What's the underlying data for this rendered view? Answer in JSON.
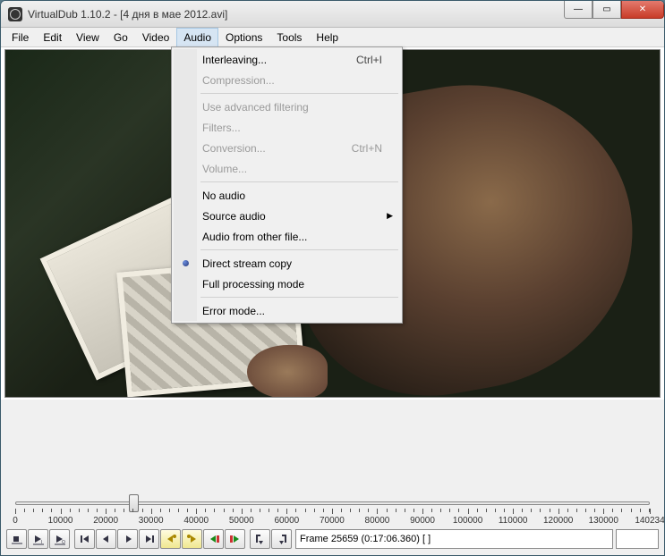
{
  "title": "VirtualDub 1.10.2 - [4 дня в мае 2012.avi]",
  "menus": {
    "file": "File",
    "edit": "Edit",
    "view": "View",
    "go": "Go",
    "video": "Video",
    "audio": "Audio",
    "options": "Options",
    "tools": "Tools",
    "help": "Help"
  },
  "audio_menu": {
    "interleaving": {
      "label": "Interleaving...",
      "accel": "Ctrl+I"
    },
    "compression": {
      "label": "Compression..."
    },
    "adv_filter": {
      "label": "Use advanced filtering"
    },
    "filters": {
      "label": "Filters..."
    },
    "conversion": {
      "label": "Conversion...",
      "accel": "Ctrl+N"
    },
    "volume": {
      "label": "Volume..."
    },
    "no_audio": {
      "label": "No audio"
    },
    "source_audio": {
      "label": "Source audio"
    },
    "audio_other": {
      "label": "Audio from other file..."
    },
    "direct_copy": {
      "label": "Direct stream copy"
    },
    "full_proc": {
      "label": "Full processing mode"
    },
    "error_mode": {
      "label": "Error mode..."
    }
  },
  "timeline": {
    "ticks": [
      "0",
      "10000",
      "20000",
      "30000",
      "40000",
      "50000",
      "60000",
      "70000",
      "80000",
      "90000",
      "100000",
      "110000",
      "120000",
      "130000",
      "140234"
    ],
    "max": 140234,
    "pos": 25659
  },
  "status": "Frame 25659 (0:17:06.360) [ ]",
  "winbtns": {
    "min": "—",
    "max": "▭",
    "close": "✕"
  },
  "icons": {
    "stop": "stop",
    "play_in": "play-in",
    "play_out": "play-out",
    "begin": "begin",
    "back": "back",
    "fwd": "fwd",
    "end": "end",
    "key_back": "key-back",
    "key_fwd": "key-fwd",
    "scene_back": "scene-back",
    "scene_fwd": "scene-fwd",
    "mark_in": "mark-in",
    "mark_out": "mark-out"
  }
}
